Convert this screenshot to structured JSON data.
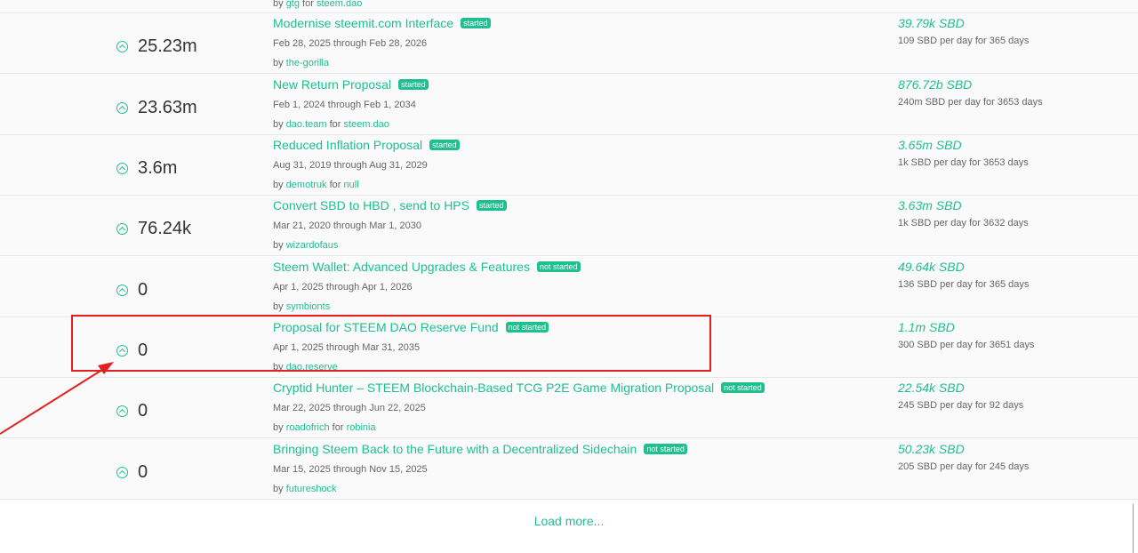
{
  "top_partial": {
    "by": "by",
    "author": "gtg",
    "for": "for",
    "receiver": "steem.dao"
  },
  "proposals": [
    {
      "votes": "25.23m",
      "title": "Modernise steemit.com Interface",
      "status": "started",
      "dates": "Feb 28, 2025 through Feb 28, 2026",
      "by": "by",
      "author": "the-gorilla",
      "for": "",
      "receiver": "",
      "amount": "39.79k SBD",
      "per_day": "109 SBD per day for 365 days"
    },
    {
      "votes": "23.63m",
      "title": "New Return Proposal",
      "status": "started",
      "dates": "Feb 1, 2024 through Feb 1, 2034",
      "by": "by",
      "author": "dao.team",
      "for": "for",
      "receiver": "steem.dao",
      "amount": "876.72b SBD",
      "per_day": "240m SBD per day for 3653 days"
    },
    {
      "votes": "3.6m",
      "title": "Reduced Inflation Proposal",
      "status": "started",
      "dates": "Aug 31, 2019 through Aug 31, 2029",
      "by": "by",
      "author": "demotruk",
      "for": "for",
      "receiver": "null",
      "amount": "3.65m SBD",
      "per_day": "1k SBD per day for 3653 days"
    },
    {
      "votes": "76.24k",
      "title": "Convert SBD to HBD , send to HPS",
      "status": "started",
      "dates": "Mar 21, 2020 through Mar 1, 2030",
      "by": "by",
      "author": "wizardofaus",
      "for": "",
      "receiver": "",
      "amount": "3.63m SBD",
      "per_day": "1k SBD per day for 3632 days"
    },
    {
      "votes": "0",
      "title": "Steem Wallet: Advanced Upgrades & Features",
      "status": "not started",
      "dates": "Apr 1, 2025 through Apr 1, 2026",
      "by": "by",
      "author": "symbionts",
      "for": "",
      "receiver": "",
      "amount": "49.64k SBD",
      "per_day": "136 SBD per day for 365 days"
    },
    {
      "votes": "0",
      "title": "Proposal for STEEM DAO Reserve Fund",
      "status": "not started",
      "dates": "Apr 1, 2025 through Mar 31, 2035",
      "by": "by",
      "author": "dao.reserve",
      "for": "",
      "receiver": "",
      "amount": "1.1m SBD",
      "per_day": "300 SBD per day for 3651 days"
    },
    {
      "votes": "0",
      "title": "Cryptid Hunter – STEEM Blockchain-Based TCG P2E Game Migration Proposal",
      "status": "not started",
      "dates": "Mar 22, 2025 through Jun 22, 2025",
      "by": "by",
      "author": "roadofrich",
      "for": "for",
      "receiver": "robinia",
      "amount": "22.54k SBD",
      "per_day": "245 SBD per day for 92 days"
    },
    {
      "votes": "0",
      "title": "Bringing Steem Back to the Future with a Decentralized Sidechain",
      "status": "not started",
      "dates": "Mar 15, 2025 through Nov 15, 2025",
      "by": "by",
      "author": "futureshock",
      "for": "",
      "receiver": "",
      "amount": "50.23k SBD",
      "per_day": "205 SBD per day for 245 days"
    }
  ],
  "load_more": "Load more...",
  "colors": {
    "accent": "#1fbf8f",
    "annotation": "#e32020"
  }
}
